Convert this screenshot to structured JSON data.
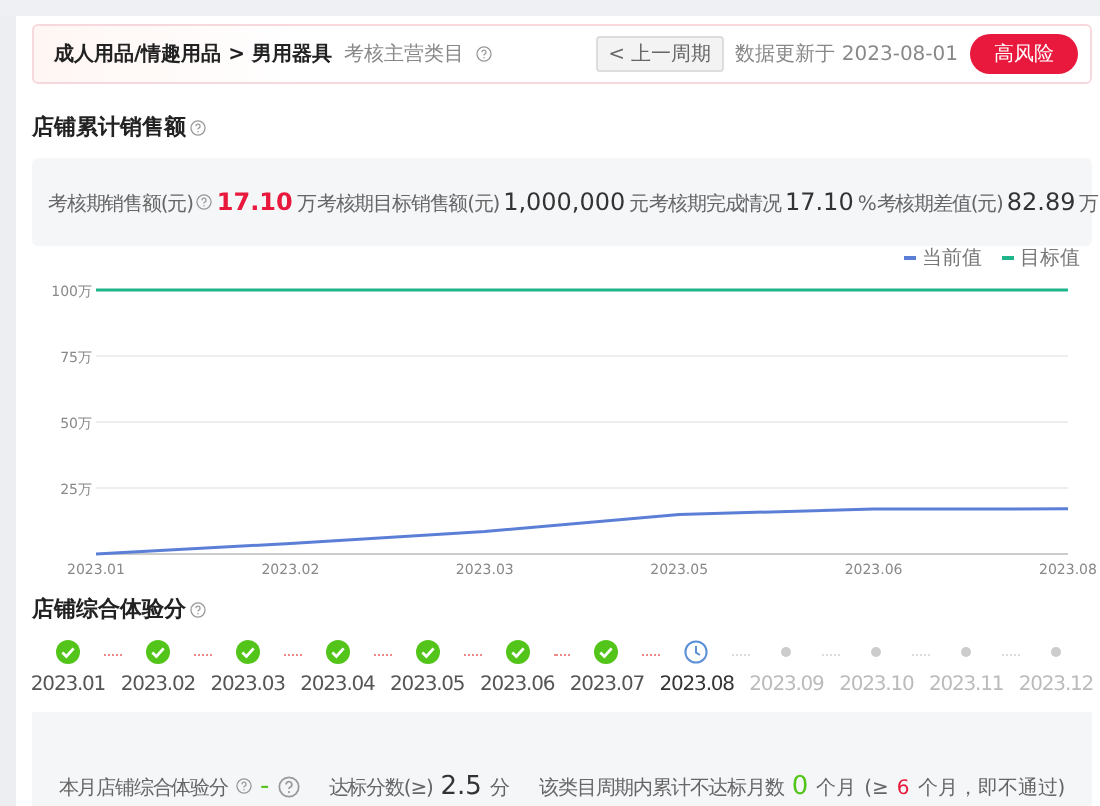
{
  "header": {
    "category": "成人用品/情趣用品 > 男用器具",
    "category_note": "考核主营类目",
    "prev_button": "< 上一周期",
    "updated": "数据更新于 2023-08-01",
    "risk_badge": "高风险"
  },
  "sales_section": {
    "title": "店铺累计销售额",
    "stats": [
      {
        "label": "考核期销售额(元)",
        "help": true,
        "value": "17.10",
        "unit": "万",
        "emphasis": true
      },
      {
        "label": "考核期目标销售额(元)",
        "help": false,
        "value": "1,000,000",
        "unit": "元",
        "emphasis": false
      },
      {
        "label": "考核期完成情况",
        "help": false,
        "value": "17.10",
        "unit": "%",
        "emphasis": false
      },
      {
        "label": "考核期差值(元)",
        "help": false,
        "value": "82.89",
        "unit": "万",
        "emphasis": false
      }
    ],
    "chart_data": {
      "type": "line",
      "grid": true,
      "categories": [
        "2023.01",
        "2023.02",
        "2023.03",
        "2023.05",
        "2023.06",
        "2023.08"
      ],
      "ylim": [
        0,
        100
      ],
      "yticks": [
        {
          "value": 25,
          "label": "25万"
        },
        {
          "value": 50,
          "label": "50万"
        },
        {
          "value": 75,
          "label": "75万"
        },
        {
          "value": 100,
          "label": "100万"
        }
      ],
      "series": [
        {
          "name": "当前值",
          "color": "#5b7fd6",
          "values": [
            0,
            4,
            8.5,
            15,
            17,
            17.1
          ]
        },
        {
          "name": "目标值",
          "color": "#1fb58a",
          "values": [
            100,
            100,
            100,
            100,
            100,
            100
          ]
        }
      ]
    }
  },
  "experience_section": {
    "title": "店铺综合体验分",
    "months": [
      {
        "label": "2023.01",
        "kind": "done"
      },
      {
        "label": "2023.02",
        "kind": "done"
      },
      {
        "label": "2023.03",
        "kind": "done"
      },
      {
        "label": "2023.04",
        "kind": "done"
      },
      {
        "label": "2023.05",
        "kind": "done"
      },
      {
        "label": "2023.06",
        "kind": "done"
      },
      {
        "label": "2023.07",
        "kind": "done"
      },
      {
        "label": "2023.08",
        "kind": "current"
      },
      {
        "label": "2023.09",
        "kind": "future"
      },
      {
        "label": "2023.10",
        "kind": "future"
      },
      {
        "label": "2023.11",
        "kind": "future"
      },
      {
        "label": "2023.12",
        "kind": "future"
      }
    ],
    "summary": {
      "score_label": "本月店铺综合体验分",
      "score_value": "-",
      "target_label": "达标分数(≥)",
      "target_value": "2.5",
      "target_unit": "分",
      "fail_label": "该类目周期内累计不达标月数",
      "fail_value": "0",
      "fail_unit": "个月",
      "fail_rule_prefix": "(≥",
      "fail_rule_count": "6",
      "fail_rule_suffix": "个月，即不通过)"
    }
  }
}
